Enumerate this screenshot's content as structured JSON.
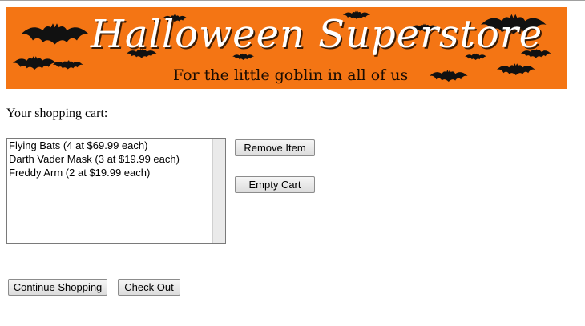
{
  "banner": {
    "title": "Halloween Superstore",
    "tagline": "For the little goblin in all of us"
  },
  "cart": {
    "label": "Your shopping cart:",
    "items": [
      "Flying Bats (4 at $69.99 each)",
      "Darth Vader Mask (3 at $19.99 each)",
      "Freddy Arm (2 at $19.99 each)"
    ]
  },
  "buttons": {
    "remove_item": "Remove Item",
    "empty_cart": "Empty Cart",
    "continue_shopping": "Continue Shopping",
    "check_out": "Check Out"
  },
  "colors": {
    "banner_background": "#f47514",
    "bat": "#111111"
  }
}
